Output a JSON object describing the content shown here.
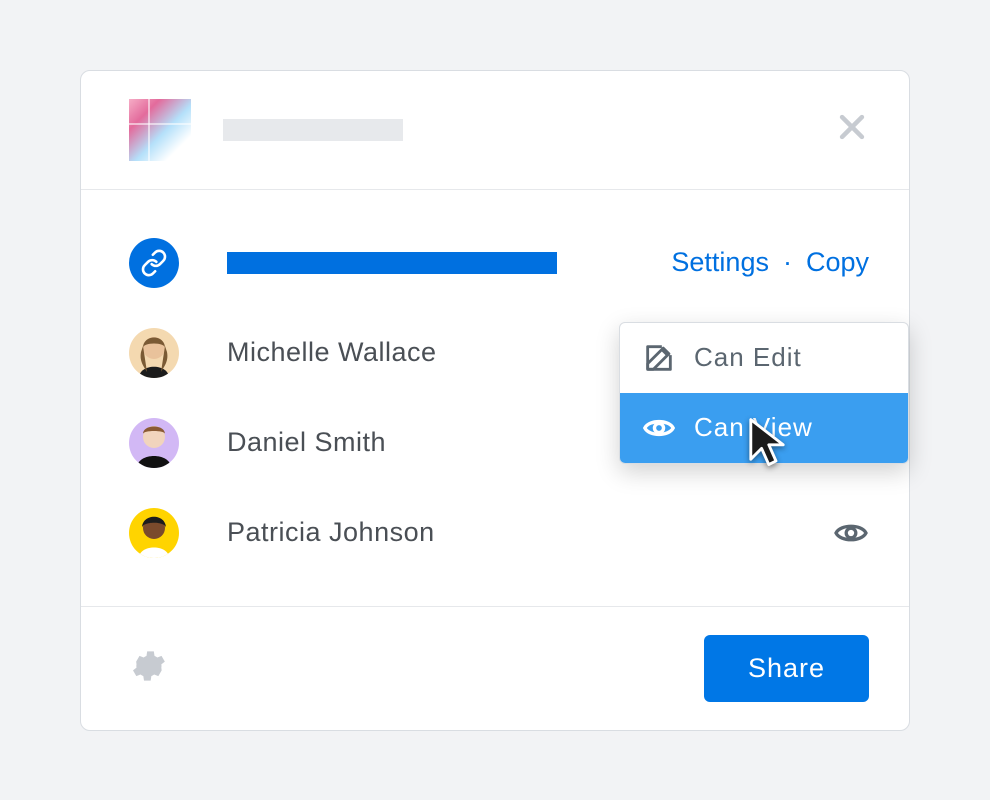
{
  "link": {
    "settings_label": "Settings",
    "copy_label": "Copy"
  },
  "people": [
    {
      "name": "Michelle Wallace",
      "avatar_bg": "#f4d9b0",
      "permission": "edit"
    },
    {
      "name": "Daniel Smith",
      "avatar_bg": "#d2b8f5",
      "permission": "edit"
    },
    {
      "name": "Patricia Johnson",
      "avatar_bg": "#ffd400",
      "permission": "view"
    }
  ],
  "permission_menu": {
    "edit_label": "Can Edit",
    "view_label": "Can View",
    "selected": "view"
  },
  "footer": {
    "share_label": "Share"
  }
}
